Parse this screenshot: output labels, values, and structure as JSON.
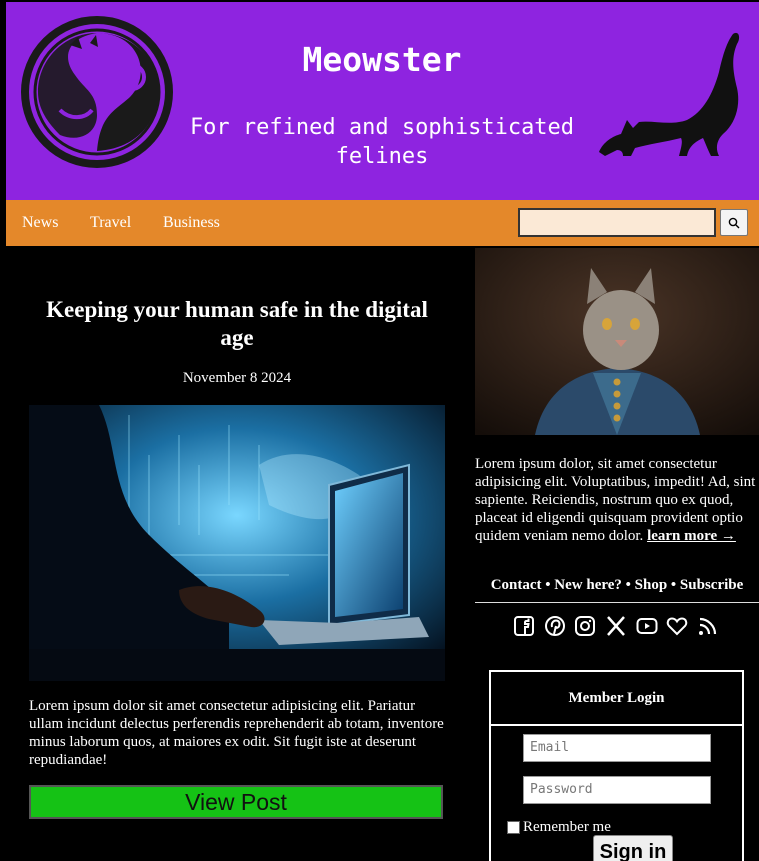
{
  "header": {
    "title": "Meowster",
    "tagline": "For refined and sophisticated felines"
  },
  "nav": {
    "links": [
      "News",
      "Travel",
      "Business"
    ],
    "search_placeholder": "",
    "search_icon": "search-icon"
  },
  "article": {
    "title": "Keeping your human safe in the digital age",
    "date": "November 8 2024",
    "body": "Lorem ipsum dolor sit amet consectetur adipisicing elit. Pariatur ullam incidunt delectus perferendis reprehenderit ab totam, inventore minus laborum quos, at maiores ex odit. Sit fugit iste at deserunt repudiandae!",
    "button_label": "View Post"
  },
  "sidebar": {
    "text": "Lorem ipsum dolor, sit amet consectetur adipisicing elit. Voluptatibus, impedit! Ad, sint sapiente. Reiciendis, nostrum quo ex quod, placeat id eligendi quisquam provident optio quidem veniam nemo dolor.",
    "learn_more": "learn more →",
    "links_line": "Contact • New here? • Shop • Subscribe",
    "social_icons": [
      "facebook-icon",
      "pinterest-icon",
      "instagram-icon",
      "x-icon",
      "youtube-icon",
      "heart-icon",
      "rss-icon"
    ]
  },
  "login": {
    "title": "Member Login",
    "email_placeholder": "Email",
    "password_placeholder": "Password",
    "remember_label": "Remember me",
    "signin_label": "Sign in"
  },
  "colors": {
    "header_bg": "#8e24e0",
    "nav_bg": "#e4882a",
    "button_green": "#15c215"
  }
}
